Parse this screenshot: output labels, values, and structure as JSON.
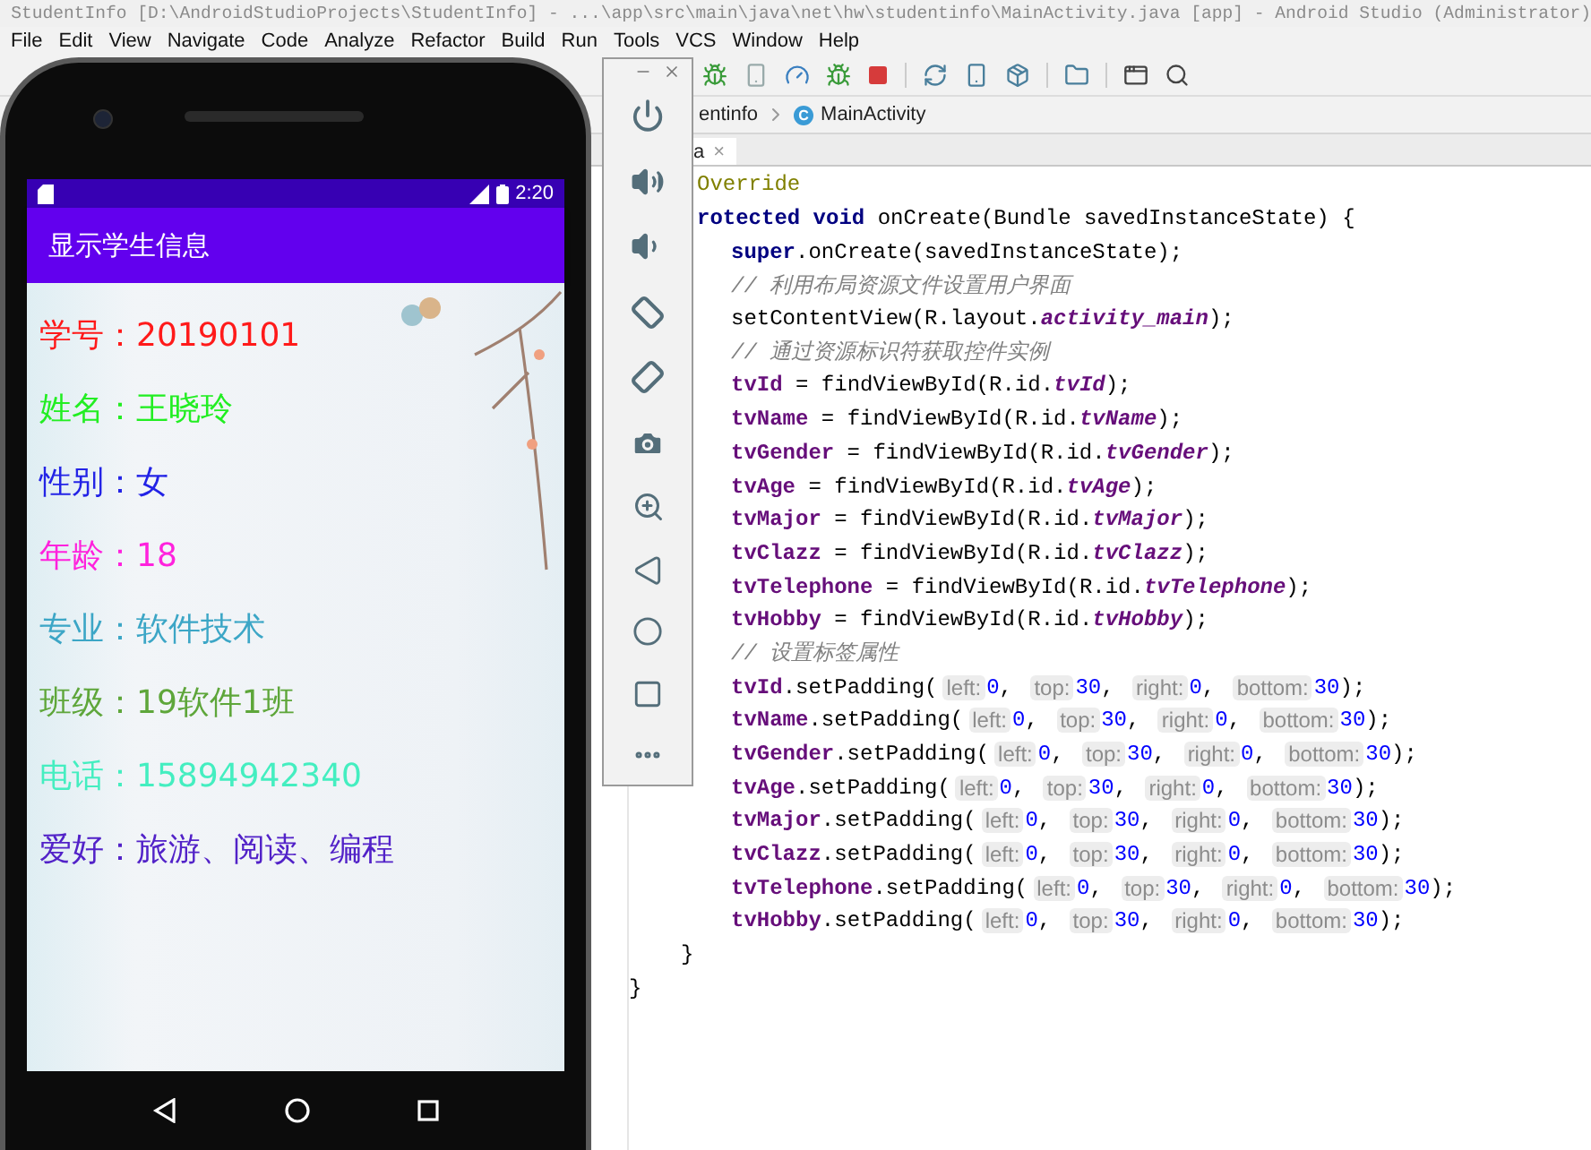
{
  "title_bar": {
    "title": "StudentInfo [D:\\AndroidStudioProjects\\StudentInfo] - ...\\app\\src\\main\\java\\net\\hw\\studentinfo\\MainActivity.java [app] - Android Studio (Administrator)"
  },
  "menu": [
    "File",
    "Edit",
    "View",
    "Navigate",
    "Code",
    "Analyze",
    "Refactor",
    "Build",
    "Run",
    "Tools",
    "VCS",
    "Window",
    "Help"
  ],
  "breadcrumb": [
    {
      "label": "entinfo",
      "kind": "package"
    },
    {
      "label": "MainActivity",
      "kind": "class",
      "icon_letter": "C"
    }
  ],
  "editor_tab": {
    "label": "a",
    "close": "×"
  },
  "code_lines": [
    {
      "kind": "head",
      "segments": [
        {
          "kind": "annotation",
          "text": "Override"
        }
      ]
    },
    {
      "kind": "head",
      "segments": [
        {
          "kind": "keyword",
          "text": "rotected void "
        },
        {
          "kind": "plain",
          "text": "onCreate(Bundle savedInstanceState) {"
        }
      ]
    },
    {
      "kind": "body",
      "segments": [
        {
          "kind": "keyword_purple",
          "text": "super"
        },
        {
          "kind": "plain",
          "text": ".onCreate(savedInstanceState);"
        }
      ]
    },
    {
      "kind": "body",
      "segments": [
        {
          "kind": "comment",
          "text": "// 利用布局资源文件设置用户界面"
        }
      ]
    },
    {
      "kind": "body",
      "segments": [
        {
          "kind": "plain",
          "text": "setContentView(R.layout."
        },
        {
          "kind": "field_italic",
          "text": "activity_main"
        },
        {
          "kind": "plain",
          "text": ");"
        }
      ]
    },
    {
      "kind": "body",
      "segments": [
        {
          "kind": "comment",
          "text": "// 通过资源标识符获取控件实例"
        }
      ]
    },
    {
      "kind": "body",
      "segments": [
        {
          "kind": "field",
          "text": "tvId"
        },
        {
          "kind": "plain",
          "text": " = findViewById(R.id."
        },
        {
          "kind": "field_italic",
          "text": "tvId"
        },
        {
          "kind": "plain",
          "text": ");"
        }
      ]
    },
    {
      "kind": "body",
      "segments": [
        {
          "kind": "field",
          "text": "tvName"
        },
        {
          "kind": "plain",
          "text": " = findViewById(R.id."
        },
        {
          "kind": "field_italic",
          "text": "tvName"
        },
        {
          "kind": "plain",
          "text": ");"
        }
      ]
    },
    {
      "kind": "body",
      "segments": [
        {
          "kind": "field",
          "text": "tvGender"
        },
        {
          "kind": "plain",
          "text": " = findViewById(R.id."
        },
        {
          "kind": "field_italic",
          "text": "tvGender"
        },
        {
          "kind": "plain",
          "text": ");"
        }
      ]
    },
    {
      "kind": "body",
      "segments": [
        {
          "kind": "field",
          "text": "tvAge"
        },
        {
          "kind": "plain",
          "text": " = findViewById(R.id."
        },
        {
          "kind": "field_italic",
          "text": "tvAge"
        },
        {
          "kind": "plain",
          "text": ");"
        }
      ]
    },
    {
      "kind": "body",
      "segments": [
        {
          "kind": "field",
          "text": "tvMajor"
        },
        {
          "kind": "plain",
          "text": " = findViewById(R.id."
        },
        {
          "kind": "field_italic",
          "text": "tvMajor"
        },
        {
          "kind": "plain",
          "text": ");"
        }
      ]
    },
    {
      "kind": "body",
      "segments": [
        {
          "kind": "field",
          "text": "tvClazz"
        },
        {
          "kind": "plain",
          "text": " = findViewById(R.id."
        },
        {
          "kind": "field_italic",
          "text": "tvClazz"
        },
        {
          "kind": "plain",
          "text": ");"
        }
      ]
    },
    {
      "kind": "body",
      "segments": [
        {
          "kind": "field",
          "text": "tvTelephone"
        },
        {
          "kind": "plain",
          "text": " = findViewById(R.id."
        },
        {
          "kind": "field_italic",
          "text": "tvTelephone"
        },
        {
          "kind": "plain",
          "text": ");"
        }
      ]
    },
    {
      "kind": "body",
      "segments": [
        {
          "kind": "field",
          "text": "tvHobby"
        },
        {
          "kind": "plain",
          "text": " = findViewById(R.id."
        },
        {
          "kind": "field_italic",
          "text": "tvHobby"
        },
        {
          "kind": "plain",
          "text": ");"
        }
      ]
    },
    {
      "kind": "body",
      "segments": [
        {
          "kind": "comment",
          "text": "// 设置标签属性"
        }
      ]
    },
    {
      "kind": "body",
      "segments": [
        {
          "kind": "field",
          "text": "tvId"
        },
        {
          "kind": "plain",
          "text": ".setPadding("
        },
        {
          "kind": "hint",
          "text": "left:"
        },
        {
          "kind": "number",
          "text": "0"
        },
        {
          "kind": "plain",
          "text": ", "
        },
        {
          "kind": "hint",
          "text": "top:"
        },
        {
          "kind": "number",
          "text": "30"
        },
        {
          "kind": "plain",
          "text": ", "
        },
        {
          "kind": "hint",
          "text": "right:"
        },
        {
          "kind": "number",
          "text": "0"
        },
        {
          "kind": "plain",
          "text": ", "
        },
        {
          "kind": "hint",
          "text": "bottom:"
        },
        {
          "kind": "number",
          "text": "30"
        },
        {
          "kind": "plain",
          "text": ");"
        }
      ]
    },
    {
      "kind": "body",
      "segments": [
        {
          "kind": "field",
          "text": "tvName"
        },
        {
          "kind": "plain",
          "text": ".setPadding("
        },
        {
          "kind": "hint",
          "text": "left:"
        },
        {
          "kind": "number",
          "text": "0"
        },
        {
          "kind": "plain",
          "text": ", "
        },
        {
          "kind": "hint",
          "text": "top:"
        },
        {
          "kind": "number",
          "text": "30"
        },
        {
          "kind": "plain",
          "text": ", "
        },
        {
          "kind": "hint",
          "text": "right:"
        },
        {
          "kind": "number",
          "text": "0"
        },
        {
          "kind": "plain",
          "text": ", "
        },
        {
          "kind": "hint",
          "text": "bottom:"
        },
        {
          "kind": "number",
          "text": "30"
        },
        {
          "kind": "plain",
          "text": ");"
        }
      ]
    },
    {
      "kind": "body",
      "segments": [
        {
          "kind": "field",
          "text": "tvGender"
        },
        {
          "kind": "plain",
          "text": ".setPadding("
        },
        {
          "kind": "hint",
          "text": "left:"
        },
        {
          "kind": "number",
          "text": "0"
        },
        {
          "kind": "plain",
          "text": ", "
        },
        {
          "kind": "hint",
          "text": "top:"
        },
        {
          "kind": "number",
          "text": "30"
        },
        {
          "kind": "plain",
          "text": ", "
        },
        {
          "kind": "hint",
          "text": "right:"
        },
        {
          "kind": "number",
          "text": "0"
        },
        {
          "kind": "plain",
          "text": ", "
        },
        {
          "kind": "hint",
          "text": "bottom:"
        },
        {
          "kind": "number",
          "text": "30"
        },
        {
          "kind": "plain",
          "text": ");"
        }
      ]
    },
    {
      "kind": "body",
      "segments": [
        {
          "kind": "field",
          "text": "tvAge"
        },
        {
          "kind": "plain",
          "text": ".setPadding("
        },
        {
          "kind": "hint",
          "text": "left:"
        },
        {
          "kind": "number",
          "text": "0"
        },
        {
          "kind": "plain",
          "text": ", "
        },
        {
          "kind": "hint",
          "text": "top:"
        },
        {
          "kind": "number",
          "text": "30"
        },
        {
          "kind": "plain",
          "text": ", "
        },
        {
          "kind": "hint",
          "text": "right:"
        },
        {
          "kind": "number",
          "text": "0"
        },
        {
          "kind": "plain",
          "text": ", "
        },
        {
          "kind": "hint",
          "text": "bottom:"
        },
        {
          "kind": "number",
          "text": "30"
        },
        {
          "kind": "plain",
          "text": ");"
        }
      ]
    },
    {
      "kind": "body",
      "segments": [
        {
          "kind": "field",
          "text": "tvMajor"
        },
        {
          "kind": "plain",
          "text": ".setPadding("
        },
        {
          "kind": "hint",
          "text": "left:"
        },
        {
          "kind": "number",
          "text": "0"
        },
        {
          "kind": "plain",
          "text": ", "
        },
        {
          "kind": "hint",
          "text": "top:"
        },
        {
          "kind": "number",
          "text": "30"
        },
        {
          "kind": "plain",
          "text": ", "
        },
        {
          "kind": "hint",
          "text": "right:"
        },
        {
          "kind": "number",
          "text": "0"
        },
        {
          "kind": "plain",
          "text": ", "
        },
        {
          "kind": "hint",
          "text": "bottom:"
        },
        {
          "kind": "number",
          "text": "30"
        },
        {
          "kind": "plain",
          "text": ");"
        }
      ]
    },
    {
      "kind": "body",
      "segments": [
        {
          "kind": "field",
          "text": "tvClazz"
        },
        {
          "kind": "plain",
          "text": ".setPadding("
        },
        {
          "kind": "hint",
          "text": "left:"
        },
        {
          "kind": "number",
          "text": "0"
        },
        {
          "kind": "plain",
          "text": ", "
        },
        {
          "kind": "hint",
          "text": "top:"
        },
        {
          "kind": "number",
          "text": "30"
        },
        {
          "kind": "plain",
          "text": ", "
        },
        {
          "kind": "hint",
          "text": "right:"
        },
        {
          "kind": "number",
          "text": "0"
        },
        {
          "kind": "plain",
          "text": ", "
        },
        {
          "kind": "hint",
          "text": "bottom:"
        },
        {
          "kind": "number",
          "text": "30"
        },
        {
          "kind": "plain",
          "text": ");"
        }
      ]
    },
    {
      "kind": "body",
      "segments": [
        {
          "kind": "field",
          "text": "tvTelephone"
        },
        {
          "kind": "plain",
          "text": ".setPadding("
        },
        {
          "kind": "hint",
          "text": "left:"
        },
        {
          "kind": "number",
          "text": "0"
        },
        {
          "kind": "plain",
          "text": ", "
        },
        {
          "kind": "hint",
          "text": "top:"
        },
        {
          "kind": "number",
          "text": "30"
        },
        {
          "kind": "plain",
          "text": ", "
        },
        {
          "kind": "hint",
          "text": "right:"
        },
        {
          "kind": "number",
          "text": "0"
        },
        {
          "kind": "plain",
          "text": ", "
        },
        {
          "kind": "hint",
          "text": "bottom:"
        },
        {
          "kind": "number",
          "text": "30"
        },
        {
          "kind": "plain",
          "text": ");"
        }
      ]
    },
    {
      "kind": "body",
      "segments": [
        {
          "kind": "field",
          "text": "tvHobby"
        },
        {
          "kind": "plain",
          "text": ".setPadding("
        },
        {
          "kind": "hint",
          "text": "left:"
        },
        {
          "kind": "number",
          "text": "0"
        },
        {
          "kind": "plain",
          "text": ", "
        },
        {
          "kind": "hint",
          "text": "top:"
        },
        {
          "kind": "number",
          "text": "30"
        },
        {
          "kind": "plain",
          "text": ", "
        },
        {
          "kind": "hint",
          "text": "right:"
        },
        {
          "kind": "number",
          "text": "0"
        },
        {
          "kind": "plain",
          "text": ", "
        },
        {
          "kind": "hint",
          "text": "bottom:"
        },
        {
          "kind": "number",
          "text": "30"
        },
        {
          "kind": "plain",
          "text": ");"
        }
      ]
    },
    {
      "kind": "method_end",
      "segments": [
        {
          "kind": "plain",
          "text": "}"
        }
      ]
    },
    {
      "kind": "class_end",
      "segments": [
        {
          "kind": "plain",
          "text": "}"
        }
      ]
    }
  ],
  "phone": {
    "status_time": "2:20",
    "app_title": "显示学生信息",
    "fields": [
      {
        "text": "学号：20190101",
        "color": "#ff1a1a"
      },
      {
        "text": "姓名：王晓玲",
        "color": "#22ee22"
      },
      {
        "text": "性别：女",
        "color": "#2323e6"
      },
      {
        "text": "年龄：18",
        "color": "#ff22dd"
      },
      {
        "text": "专业：软件技术",
        "color": "#3ca6c6"
      },
      {
        "text": "班级：19软件1班",
        "color": "#5ea63a"
      },
      {
        "text": "电话：15894942340",
        "color": "#44eec0"
      },
      {
        "text": "爱好：旅游、阅读、编程",
        "color": "#5222c8"
      }
    ]
  }
}
